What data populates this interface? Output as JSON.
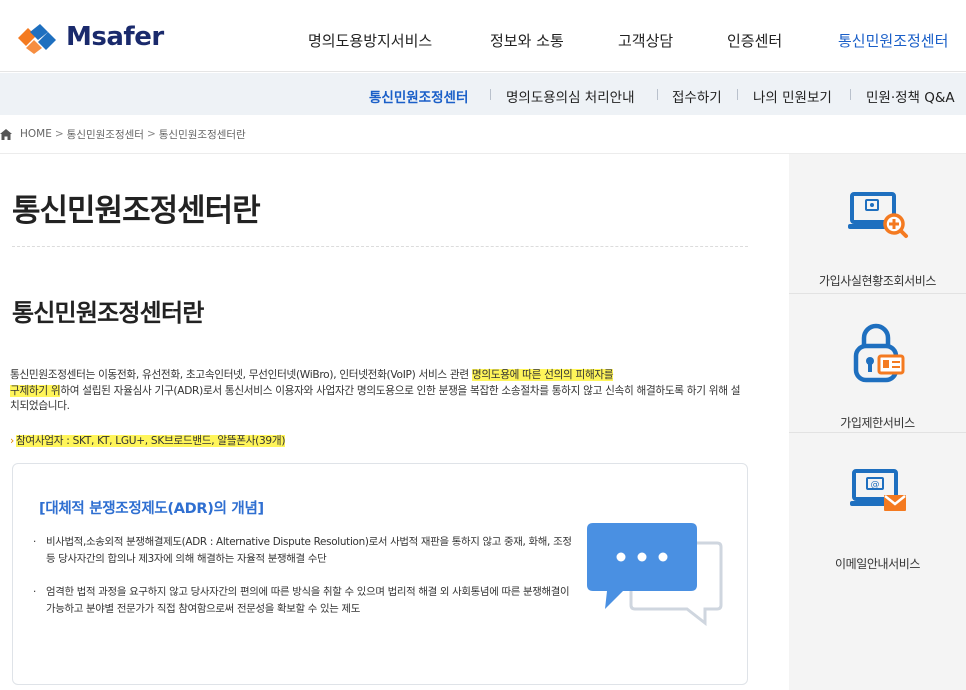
{
  "header": {
    "logo_text": "Msafer",
    "nav": [
      {
        "label": "명의도용방지서비스",
        "active": false
      },
      {
        "label": "정보와 소통",
        "active": false
      },
      {
        "label": "고객상담",
        "active": false
      },
      {
        "label": "인증센터",
        "active": false
      },
      {
        "label": "통신민원조정센터",
        "active": true
      }
    ]
  },
  "subnav": [
    {
      "label": "통신민원조정센터",
      "active": true
    },
    {
      "label": "명의도용의심 처리안내",
      "active": false
    },
    {
      "label": "접수하기",
      "active": false
    },
    {
      "label": "나의 민원보기",
      "active": false
    },
    {
      "label": "민원·정책 Q&A",
      "active": false
    }
  ],
  "breadcrumb": [
    "HOME",
    "통신민원조정센터",
    "통신민원조정센터란"
  ],
  "main": {
    "page_title": "통신민원조정센터란",
    "section_title": "통신민원조정센터란",
    "body_part1": "통신민원조정센터는 이동전화, 유선전화, 초고속인터넷, 무선인터넷(WiBro), 인터넷전화(VoIP) 서비스 관련 ",
    "body_highlight1": "명의도용에 따른 선의의 피해자를",
    "body_highlight2": "구제하기 위",
    "body_part2": "하여 설립된 자율심사 기구(ADR)로서 통신서비스 이용자와 사업자간 명의도용으로 인한 분쟁을 복잡한 소송절차를 통하지 않고 신속히 해결하도록 하기 위해 설치되었습니다.",
    "participants_prefix": "›",
    "participants_text": "참여사업자 : SKT, KT, LGU+, SK브로드밴드, 알뜰폰사(39개)",
    "card": {
      "title": "[대체적 분쟁조정제도(ADR)의 개념]",
      "bullet": "·",
      "items": [
        {
          "text": "비사법적,소송외적 분쟁해결제도(ADR : Alternative Dispute Resolution)로서 사법적 재판을 통하지 않고 중재, 화해, 조정 등 당사자간의 합의나 제3자에 의해 해결하는 자율적 분쟁해결 수단"
        },
        {
          "text": "엄격한 법적 과정을 요구하지 않고 당사자간의 편의에 따른 방식을 취할 수 있으며 법리적 해결 외 사회통념에 따른 분쟁해결이 가능하고 분야별 전문가가 직접 참여함으로써 전문성을 확보할 수 있는 제도"
        }
      ]
    }
  },
  "sidebar": [
    {
      "label": "가입사실현황조회서비스",
      "icon": "monitor-search-icon"
    },
    {
      "label": "가입제한서비스",
      "icon": "lock-id-icon"
    },
    {
      "label": "이메일안내서비스",
      "icon": "monitor-mail-icon"
    }
  ],
  "colors": {
    "primary_blue": "#1a5fc8",
    "card_title_blue": "#2f6fd1",
    "icon_blue": "#1e6fbf",
    "icon_orange": "#f47a20",
    "highlight_yellow": "#fff55a",
    "subnav_bg": "#eef2f6",
    "sidebar_bg": "#f4f4f4"
  }
}
